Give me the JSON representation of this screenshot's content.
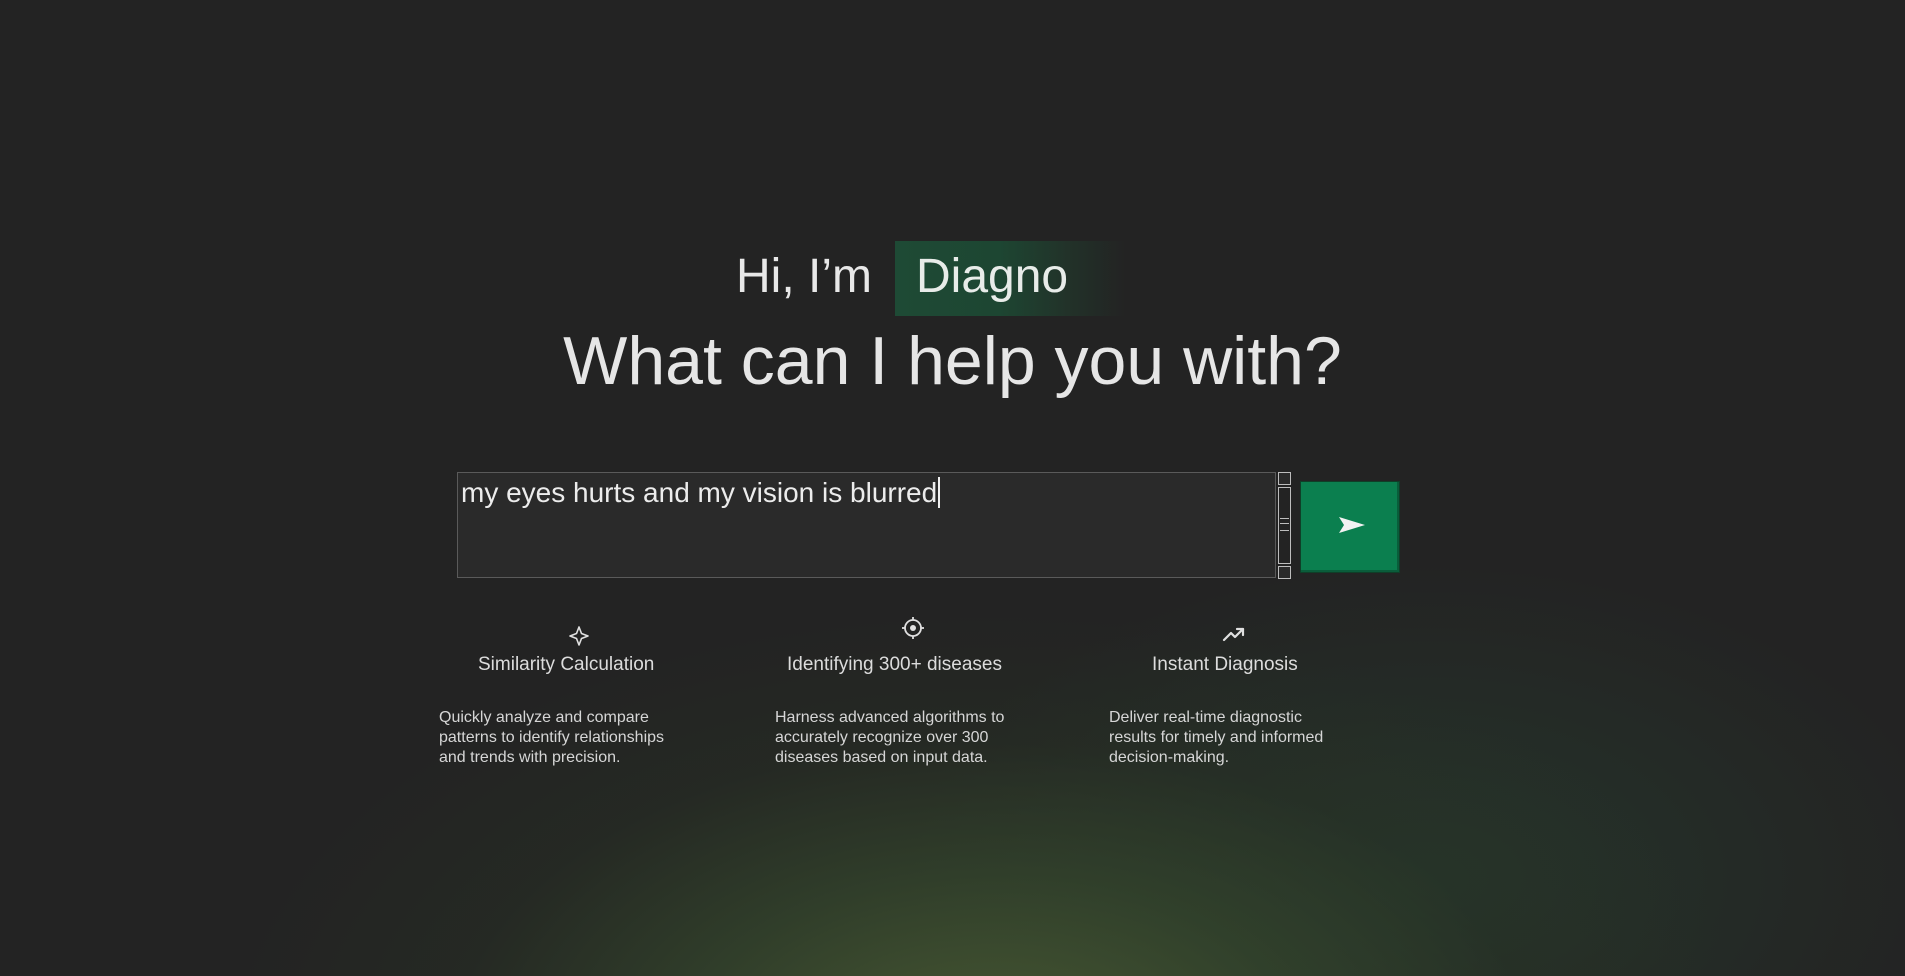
{
  "greeting": {
    "prefix": "Hi, I’m",
    "name": "Diagno"
  },
  "headline": "What can I help you with?",
  "query": {
    "value": "my eyes hurts and my vision is blurred",
    "placeholder": ""
  },
  "send_button": {
    "icon": "send-arrow-icon",
    "color": "#0b7f4f"
  },
  "features": [
    {
      "icon": "sparkle-icon",
      "title": "Similarity Calculation",
      "description": "Quickly analyze and compare patterns to identify relationships and trends with precision."
    },
    {
      "icon": "target-icon",
      "title": "Identifying 300+ diseases",
      "description": "Harness advanced algorithms to accurately recognize over 300 diseases based on input data."
    },
    {
      "icon": "trending-up-icon",
      "title": "Instant Diagnosis",
      "description": "Deliver real-time diagnostic results for timely and informed decision-making."
    }
  ],
  "colors": {
    "accent": "#0b7f4f",
    "badge": "#1e4a35",
    "background": "#232323"
  }
}
